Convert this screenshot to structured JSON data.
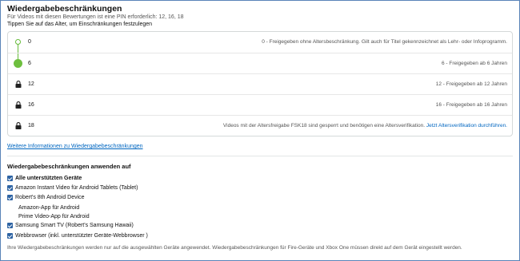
{
  "header": {
    "title": "Wiedergabebeschränkungen",
    "subtitle": "Für Videos mit diesen Bewertungen ist eine PIN erforderlich: 12, 16, 18",
    "hint": "Tippen Sie auf das Alter, um Einschränkungen festzulegen"
  },
  "ratings": [
    {
      "label": "0",
      "state": "unlocked-open",
      "description": "0 - Freigegeben ohne Altersbeschränkung. Gilt auch für Titel gekennzeichnet als Lehr- oder Infoprogramm."
    },
    {
      "label": "6",
      "state": "selected",
      "description": "6 - Freigegeben ab 6 Jahren"
    },
    {
      "label": "12",
      "state": "locked",
      "description": "12 - Freigegeben ab 12 Jahren"
    },
    {
      "label": "16",
      "state": "locked",
      "description": "16 - Freigegeben ab 16 Jahren"
    },
    {
      "label": "18",
      "state": "locked",
      "description": "Videos mit der Altersfreigabe FSK18 sind gesperrt und benötigen eine Altersverifikation.",
      "link": "Jetzt Altersverifikation durchführen."
    }
  ],
  "more_info_link": "Weitere Informationen zu Wiedergabebeschränkungen",
  "apply": {
    "title": "Wiedergabebeschränkungen anwenden auf",
    "devices": [
      {
        "label": "Alle unterstützten Geräte",
        "checked": true,
        "bold": true
      },
      {
        "label": "Amazon Instant Video für Android Tablets (Tablet)",
        "checked": true
      },
      {
        "label": "Robert's 8th Android Device",
        "checked": true
      },
      {
        "label": "Samsung Smart TV (Robert's Samsung Hawaii)",
        "checked": true
      },
      {
        "label": "Webbrowser (inkl. unterstützter Geräte-Webbrowser )",
        "checked": true
      }
    ],
    "subdevices": [
      "Amazon-App für Android",
      "Prime Video-App für Android"
    ]
  },
  "footer": "Ihre Wiedergabebeschränkungen werden nur auf die ausgewählten Geräte angewendet. Wiedergabebeschränkungen für Fire-Geräte und Xbox One müssen direkt auf dem Gerät eingestellt werden.",
  "colors": {
    "accent": "#66bb3b",
    "link": "#0066c0",
    "checkbox": "#2d63a3",
    "border": "#5a84b8"
  }
}
